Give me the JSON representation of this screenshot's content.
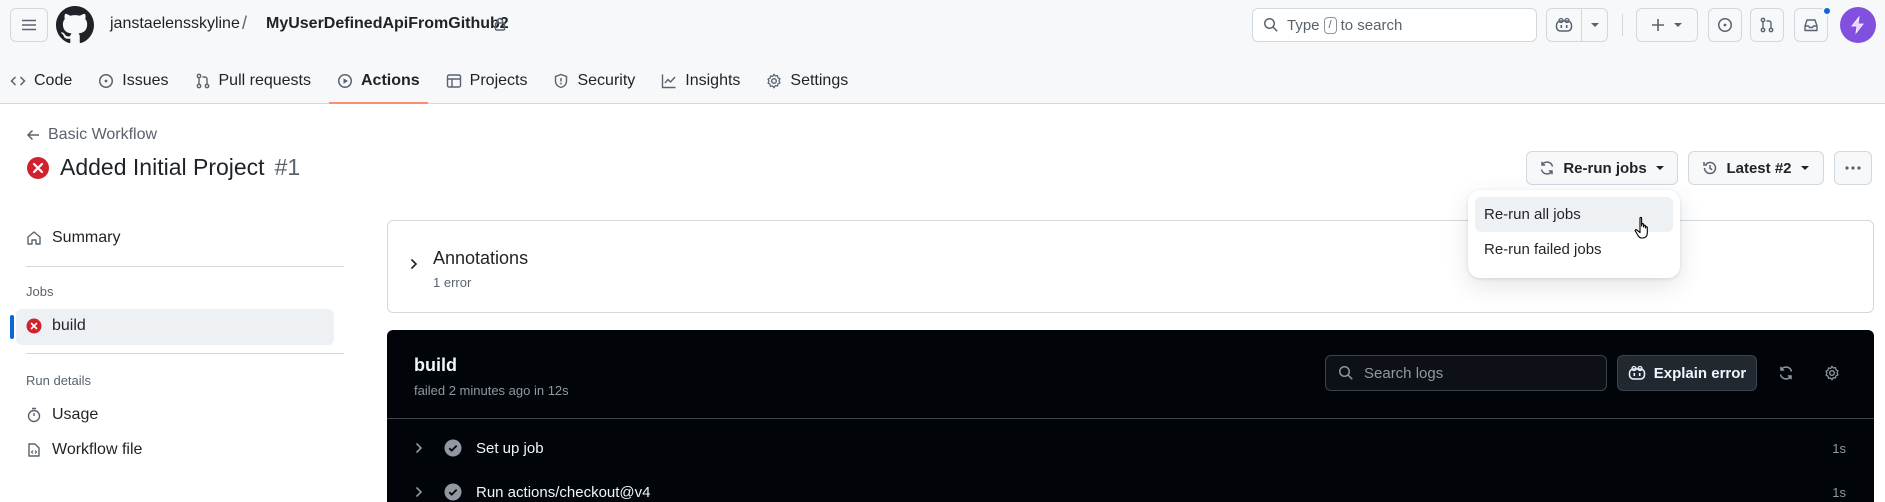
{
  "header": {
    "owner": "janstaelensskyline",
    "separator": "/",
    "repo": "MyUserDefinedApiFromGithub2",
    "search_prefix": "Type",
    "search_key": "/",
    "search_suffix": "to search"
  },
  "tabs": [
    {
      "label": "Code",
      "icon": "code-icon"
    },
    {
      "label": "Issues",
      "icon": "issue-icon"
    },
    {
      "label": "Pull requests",
      "icon": "pull-request-icon"
    },
    {
      "label": "Actions",
      "icon": "play-icon",
      "active": true
    },
    {
      "label": "Projects",
      "icon": "table-icon"
    },
    {
      "label": "Security",
      "icon": "shield-icon"
    },
    {
      "label": "Insights",
      "icon": "graph-icon"
    },
    {
      "label": "Settings",
      "icon": "gear-icon"
    }
  ],
  "run": {
    "back_label": "Basic Workflow",
    "title": "Added Initial Project",
    "number": "#1",
    "status": "failed"
  },
  "actions": {
    "rerun_label": "Re-run jobs",
    "latest_label": "Latest #2"
  },
  "rerun_menu": {
    "items": [
      "Re-run all jobs",
      "Re-run failed jobs"
    ]
  },
  "sidebar": {
    "summary": "Summary",
    "jobs_heading": "Jobs",
    "job": "build",
    "run_details_heading": "Run details",
    "usage": "Usage",
    "workflow_file": "Workflow file"
  },
  "annotations": {
    "title": "Annotations",
    "subtitle": "1 error"
  },
  "logs": {
    "job_title": "build",
    "job_subtitle": "failed 2 minutes ago in 12s",
    "search_placeholder": "Search logs",
    "explain_label": "Explain error",
    "steps": [
      {
        "name": "Set up job",
        "time": "1s"
      },
      {
        "name": "Run actions/checkout@v4",
        "time": "1s"
      }
    ]
  },
  "colors": {
    "error": "#cf222e",
    "accent": "#0969da",
    "tab_underline": "#fd8c73",
    "log_background": "#010409"
  }
}
